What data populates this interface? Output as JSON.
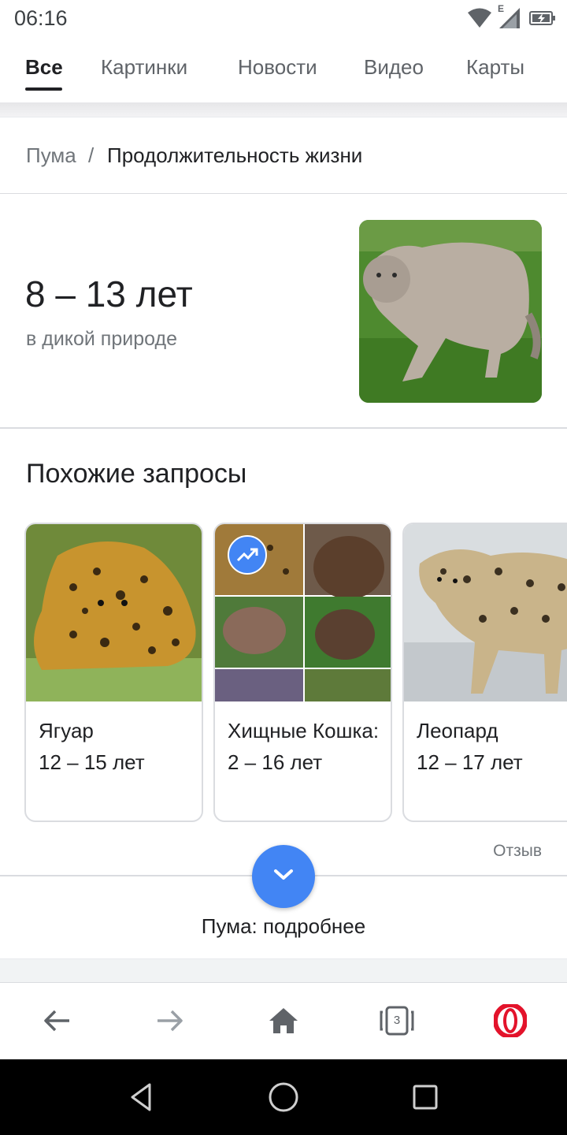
{
  "status": {
    "time": "06:16",
    "network_label": "E",
    "icons": [
      "wifi-icon",
      "cell-signal-icon",
      "battery-charging-icon"
    ]
  },
  "tabs": [
    {
      "label": "Все",
      "active": true
    },
    {
      "label": "Картинки",
      "active": false
    },
    {
      "label": "Новости",
      "active": false
    },
    {
      "label": "Видео",
      "active": false
    },
    {
      "label": "Карты",
      "active": false
    }
  ],
  "breadcrumb": {
    "parent": "Пума",
    "separator": "/",
    "current": "Продолжительность жизни"
  },
  "answer": {
    "value": "8 – 13 лет",
    "context": "в дикой природе",
    "image": "puma-photo"
  },
  "related": {
    "title": "Похожие запросы",
    "items": [
      {
        "name": "Ягуар",
        "value": "12 – 15 лет",
        "image": "jaguar-photo",
        "trending": false
      },
      {
        "name": "Хищные Кошка: 2 – 16 лет",
        "value": "",
        "image": "predators-collage",
        "trending": true
      },
      {
        "name": "Леопард",
        "value": "12 – 17 лет",
        "image": "leopard-photo",
        "trending": false
      }
    ]
  },
  "feedback_label": "Отзыв",
  "more": {
    "label": "Пума: подробнее"
  },
  "toolbar": {
    "tab_count": "3",
    "icons": [
      "back-arrow-icon",
      "forward-arrow-icon",
      "home-icon",
      "tabs-icon",
      "opera-logo-icon"
    ]
  },
  "colors": {
    "accent": "#4285f4",
    "opera_red": "#e3132b",
    "text": "#202124",
    "secondary_text": "#70757a"
  }
}
